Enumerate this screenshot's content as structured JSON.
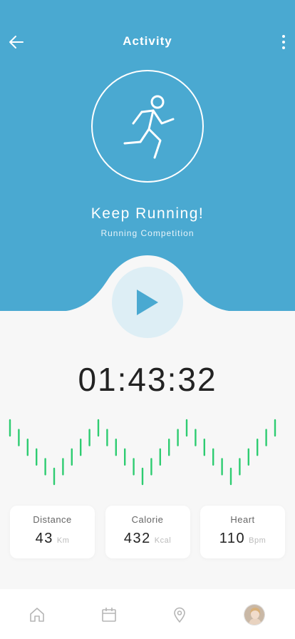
{
  "header": {
    "title": "Activity",
    "back_icon": "arrow-left-icon",
    "menu_icon": "more-vertical-icon"
  },
  "hero": {
    "icon": "running-person-icon",
    "headline": "Keep Running!",
    "subline": "Running Competition",
    "play_icon": "play-icon",
    "colors": {
      "accent": "#4aa9d1",
      "play_bg": "#ddeef5",
      "play_icon": "#4aa9d1"
    }
  },
  "timer": {
    "value": "01:43:32"
  },
  "activity_wave": {
    "color": "#2ecc71",
    "bar_count": 31
  },
  "stats": [
    {
      "label": "Distance",
      "value": "43",
      "unit": "Km"
    },
    {
      "label": "Calorie",
      "value": "432",
      "unit": "Kcal"
    },
    {
      "label": "Heart",
      "value": "110",
      "unit": "Bpm"
    }
  ],
  "tabbar": {
    "items": [
      "home-icon",
      "calendar-icon",
      "location-pin-icon",
      "profile-avatar"
    ],
    "inactive_color": "#b5b5b5"
  }
}
